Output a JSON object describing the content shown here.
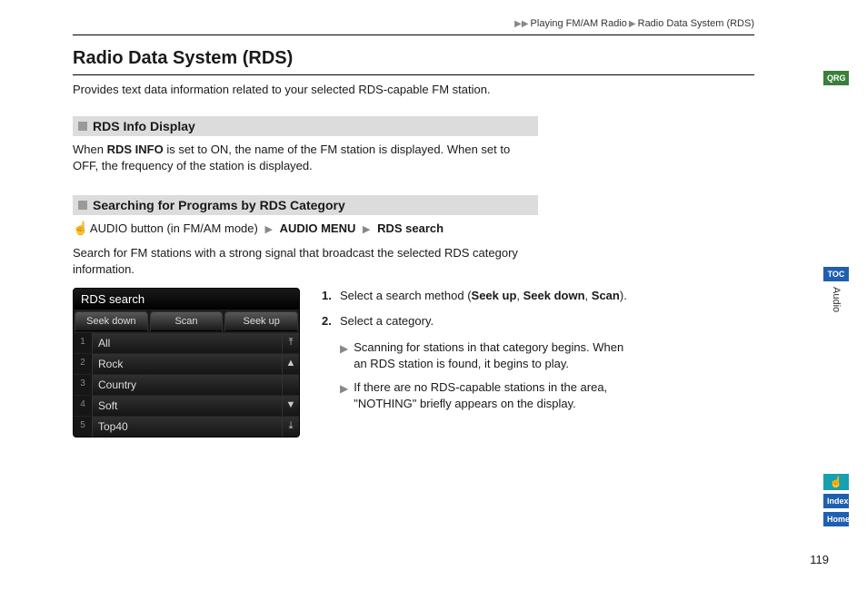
{
  "breadcrumb": {
    "seg1": "Playing FM/AM Radio",
    "seg2": "Radio Data System (RDS)"
  },
  "title": "Radio Data System (RDS)",
  "intro": "Provides text data information related to your selected RDS-capable FM station.",
  "section1": {
    "heading": "RDS Info Display",
    "body_pre": "When ",
    "body_bold": "RDS INFO",
    "body_post": " is set to ON, the name of the FM station is displayed. When set to OFF, the frequency of the station is displayed."
  },
  "section2": {
    "heading": "Searching for Programs by RDS Category",
    "path_p1": "AUDIO button (in FM/AM mode)",
    "path_p2": "AUDIO MENU",
    "path_p3": "RDS search",
    "body": "Search for FM stations with a strong signal that broadcast the selected RDS category information."
  },
  "rds_screen": {
    "title": "RDS search",
    "tabs": [
      "Seek down",
      "Scan",
      "Seek up"
    ],
    "rows": [
      {
        "n": "1",
        "label": "All",
        "arrow": "⤒"
      },
      {
        "n": "2",
        "label": "Rock",
        "arrow": "▲"
      },
      {
        "n": "3",
        "label": "Country",
        "arrow": ""
      },
      {
        "n": "4",
        "label": "Soft",
        "arrow": "▼"
      },
      {
        "n": "5",
        "label": "Top40",
        "arrow": "⤓"
      }
    ]
  },
  "steps": {
    "s1_num": "1.",
    "s1_pre": "Select a search method (",
    "s1_b1": "Seek up",
    "s1_mid1": ", ",
    "s1_b2": "Seek down",
    "s1_mid2": ", ",
    "s1_b3": "Scan",
    "s1_post": ").",
    "s2_num": "2.",
    "s2_text": "Select a category.",
    "sub1": "Scanning for stations in that category begins. When an RDS station is found, it begins to play.",
    "sub2": "If there are no RDS-capable stations in the area, \"NOTHING\" briefly appears on the display."
  },
  "side": {
    "qrg": "QRG",
    "toc": "TOC",
    "audio": "Audio",
    "index": "Index",
    "home": "Home",
    "icon": "☝"
  },
  "pagenum": "119"
}
